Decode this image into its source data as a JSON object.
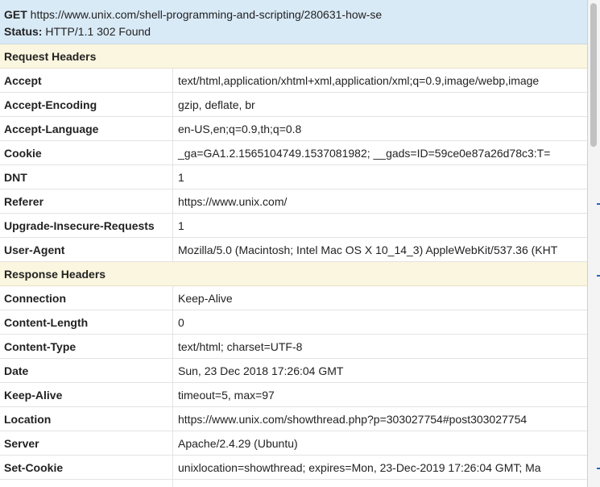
{
  "request": {
    "method": "GET",
    "url": "https://www.unix.com/shell-programming-and-scripting/280631-how-se",
    "status_label": "Status:",
    "status_value": "HTTP/1.1 302 Found"
  },
  "request_headers": {
    "title": "Request Headers",
    "rows": [
      {
        "name": "Accept",
        "value": "text/html,application/xhtml+xml,application/xml;q=0.9,image/webp,image"
      },
      {
        "name": "Accept-Encoding",
        "value": "gzip, deflate, br"
      },
      {
        "name": "Accept-Language",
        "value": "en-US,en;q=0.9,th;q=0.8"
      },
      {
        "name": "Cookie",
        "value": "_ga=GA1.2.1565104749.1537081982; __gads=ID=59ce0e87a26d78c3:T="
      },
      {
        "name": "DNT",
        "value": "1"
      },
      {
        "name": "Referer",
        "value": "https://www.unix.com/"
      },
      {
        "name": "Upgrade-Insecure-Requests",
        "value": "1"
      },
      {
        "name": "User-Agent",
        "value": "Mozilla/5.0 (Macintosh; Intel Mac OS X 10_14_3) AppleWebKit/537.36 (KHT"
      }
    ]
  },
  "response_headers": {
    "title": "Response Headers",
    "rows": [
      {
        "name": "Connection",
        "value": "Keep-Alive"
      },
      {
        "name": "Content-Length",
        "value": "0"
      },
      {
        "name": "Content-Type",
        "value": "text/html; charset=UTF-8"
      },
      {
        "name": "Date",
        "value": "Sun, 23 Dec 2018 17:26:04 GMT"
      },
      {
        "name": "Keep-Alive",
        "value": "timeout=5, max=97"
      },
      {
        "name": "Location",
        "value": "https://www.unix.com/showthread.php?p=303027754#post303027754"
      },
      {
        "name": "Server",
        "value": "Apache/2.4.29 (Ubuntu)"
      },
      {
        "name": "Set-Cookie",
        "value": "unixlocation=showthread; expires=Mon, 23-Dec-2019 17:26:04 GMT; Ma"
      }
    ]
  }
}
